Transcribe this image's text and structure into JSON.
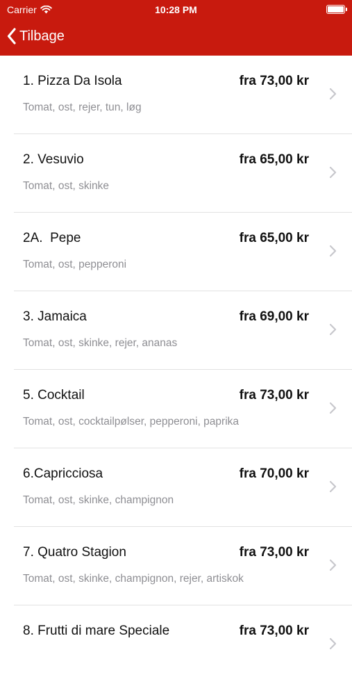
{
  "status_bar": {
    "carrier": "Carrier",
    "time": "10:28 PM"
  },
  "nav": {
    "back_label": "Tilbage"
  },
  "colors": {
    "header_bg": "#c81a0e",
    "text_primary": "#111111",
    "text_secondary": "#8e8e93"
  },
  "menu_items": [
    {
      "title": "1. Pizza Da Isola",
      "price": "fra 73,00 kr",
      "description": "Tomat, ost, rejer, tun, løg"
    },
    {
      "title": "2. Vesuvio",
      "price": "fra 65,00 kr",
      "description": "Tomat, ost, skinke"
    },
    {
      "title": "2A.  Pepe",
      "price": "fra 65,00 kr",
      "description": "Tomat, ost, pepperoni"
    },
    {
      "title": "3. Jamaica",
      "price": "fra 69,00 kr",
      "description": "Tomat, ost, skinke, rejer, ananas"
    },
    {
      "title": "5. Cocktail",
      "price": "fra 73,00 kr",
      "description": "Tomat, ost, cocktailpølser, pepperoni, paprika"
    },
    {
      "title": "6.Capricciosa",
      "price": "fra 70,00 kr",
      "description": "Tomat, ost, skinke, champignon"
    },
    {
      "title": "7. Quatro Stagion",
      "price": "fra 73,00 kr",
      "description": "Tomat, ost, skinke, champignon, rejer, artiskok"
    },
    {
      "title": "8. Frutti di mare Speciale",
      "price": "fra 73,00 kr",
      "description": ""
    }
  ]
}
